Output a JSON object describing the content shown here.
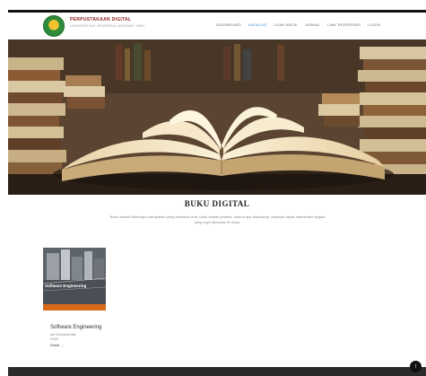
{
  "header": {
    "brand_title": "PERPUSTAKAAN DIGITAL",
    "brand_subtitle": "UNIVERSITAS JENDERAL ACHMAD YANI",
    "nav": [
      {
        "label": "DASHBOARD",
        "active": false
      },
      {
        "label": "KATALOG",
        "active": true
      },
      {
        "label": "LOAN BOOK",
        "active": false
      },
      {
        "label": "JURNAL",
        "active": false
      },
      {
        "label": "LINK REFERENSI",
        "active": false
      },
      {
        "label": "LOGIN",
        "active": false
      }
    ]
  },
  "section": {
    "title": "BUKU DIGITAL",
    "description": "Buku adalah Beberapa merupakan yang berkaitan erat. Buku adalah jendela, karena apa dibacanya, manusia dapat memahami segala yang ingin diketahui di dunia."
  },
  "books": [
    {
      "cover_text": "Software Engineering",
      "title": "Software Engineering",
      "author": "Ian Sommerville",
      "year": "2016",
      "link_label": "Detail →"
    }
  ],
  "back_to_top": "↑",
  "colors": {
    "brand_title": "#8a2424",
    "nav_active": "#2a7fd4",
    "footer": "#2b2b2b",
    "cover_accent": "#d86a1a"
  }
}
